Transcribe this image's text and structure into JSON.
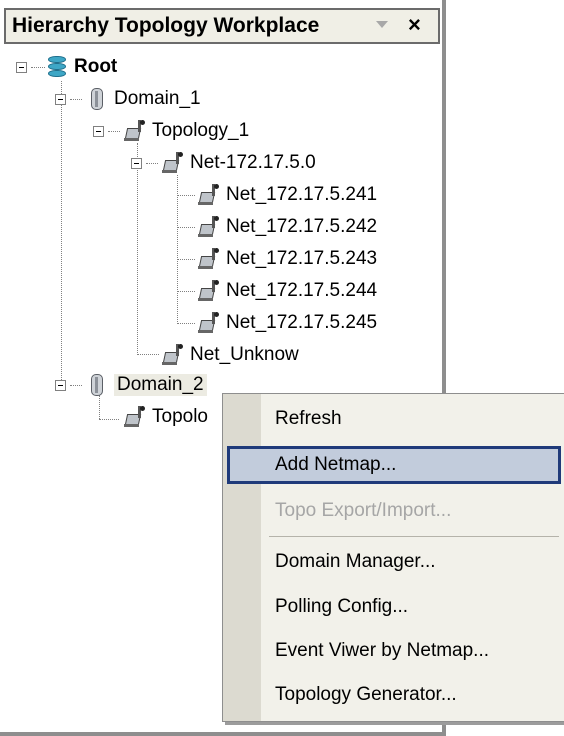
{
  "panel": {
    "title": "Hierarchy Topology Workplace",
    "close_symbol": "×"
  },
  "tree": {
    "root": "Root",
    "domain1": "Domain_1",
    "topology1": "Topology_1",
    "net_group": "Net-172.17.5.0",
    "nets": [
      "Net_172.17.5.241",
      "Net_172.17.5.242",
      "Net_172.17.5.243",
      "Net_172.17.5.244",
      "Net_172.17.5.245"
    ],
    "net_unknow": "Net_Unknow",
    "domain2": "Domain_2",
    "domain2_child": "Topolo"
  },
  "context_menu": {
    "items": [
      {
        "label": "Refresh",
        "state": "normal"
      },
      {
        "label": "Add Netmap...",
        "state": "highlighted"
      },
      {
        "label": "Topo Export/Import...",
        "state": "disabled"
      },
      {
        "label": "Domain Manager...",
        "state": "normal"
      },
      {
        "label": "Polling Config...",
        "state": "normal"
      },
      {
        "label": "Event Viwer by Netmap...",
        "state": "normal"
      },
      {
        "label": "Topology Generator...",
        "state": "normal"
      }
    ]
  },
  "colors": {
    "highlight_bg": "#c2ccdc",
    "highlight_border": "#1f3a7a",
    "menu_bg": "#f2f1ea",
    "disabled_text": "#a6a6a6"
  }
}
